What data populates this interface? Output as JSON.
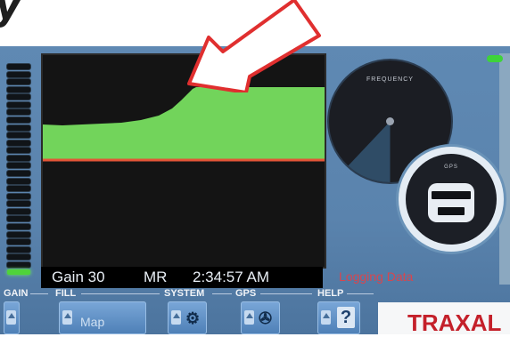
{
  "photo": {
    "title": "y"
  },
  "status_bar": {
    "gain": "Gain 30",
    "mode": "MR",
    "time": "2:34:57 AM"
  },
  "logging": {
    "text": "Logging Data"
  },
  "dials": {
    "big_label": "FREQUENCY",
    "small_label": "GPS"
  },
  "toolbar": {
    "gain_label": "GAIN",
    "fill_label": "FILL",
    "fill_button": "Map",
    "system_label": "SYSTEM",
    "gps_label": "GPS",
    "help_label": "HELP",
    "help_glyph": "?"
  },
  "brand": {
    "name": "TRAXAL"
  },
  "gain_meter": {
    "segments": 28,
    "active": 1
  },
  "colors": {
    "profile_fill": "#72d45b",
    "bottom_line": "#e35537",
    "arrow_outline": "#e02f2f",
    "brand": "#c4202a"
  },
  "annotation_arrow": {
    "color": "red",
    "direction": "pointing-down-left"
  }
}
